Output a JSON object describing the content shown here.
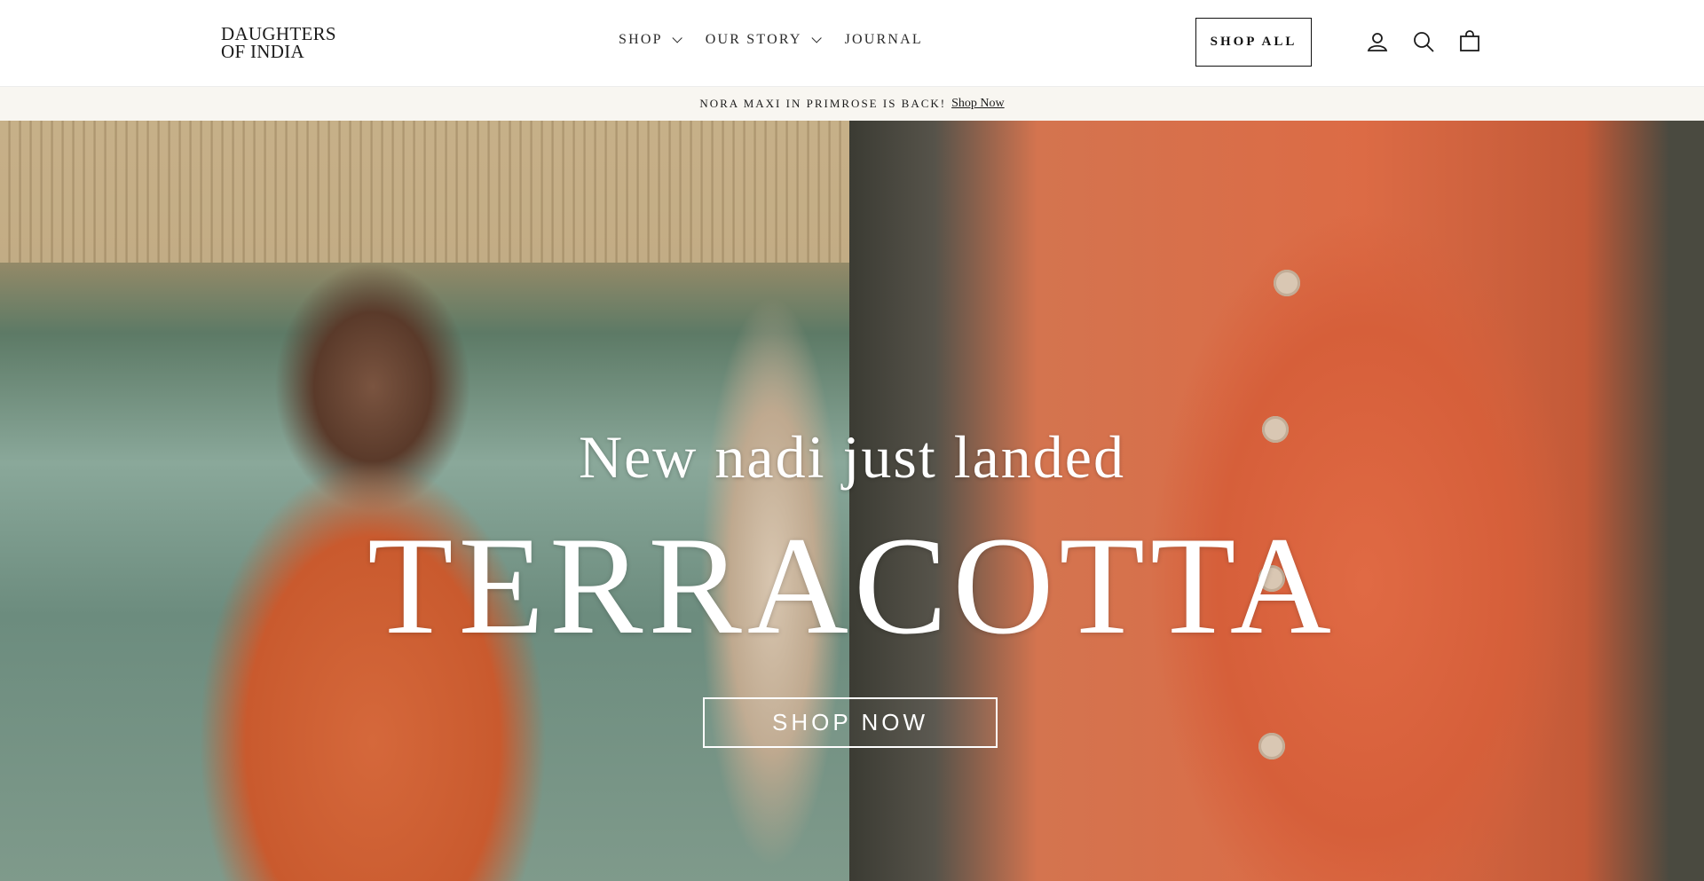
{
  "header": {
    "logo_line1": "DAUGHTERS",
    "logo_line2": "OF INDIA",
    "nav": [
      {
        "label": "SHOP",
        "has_dropdown": true
      },
      {
        "label": "OUR STORY",
        "has_dropdown": true
      },
      {
        "label": "JOURNAL",
        "has_dropdown": false
      }
    ],
    "shop_all_label": "SHOP ALL",
    "icons": [
      "account-icon",
      "search-icon",
      "cart-icon"
    ]
  },
  "announcement": {
    "text": "NORA MAXI IN PRIMROSE IS BACK!",
    "link_label": "Shop Now"
  },
  "hero": {
    "subtitle": "New nadi just landed",
    "title": "TERRACOTTA",
    "cta_label": "SHOP NOW"
  },
  "colors": {
    "header_bg": "#ffffff",
    "announcement_bg": "#f8f6f1",
    "text_dark": "#1b1b1b",
    "terracotta": "#d65f3a"
  }
}
